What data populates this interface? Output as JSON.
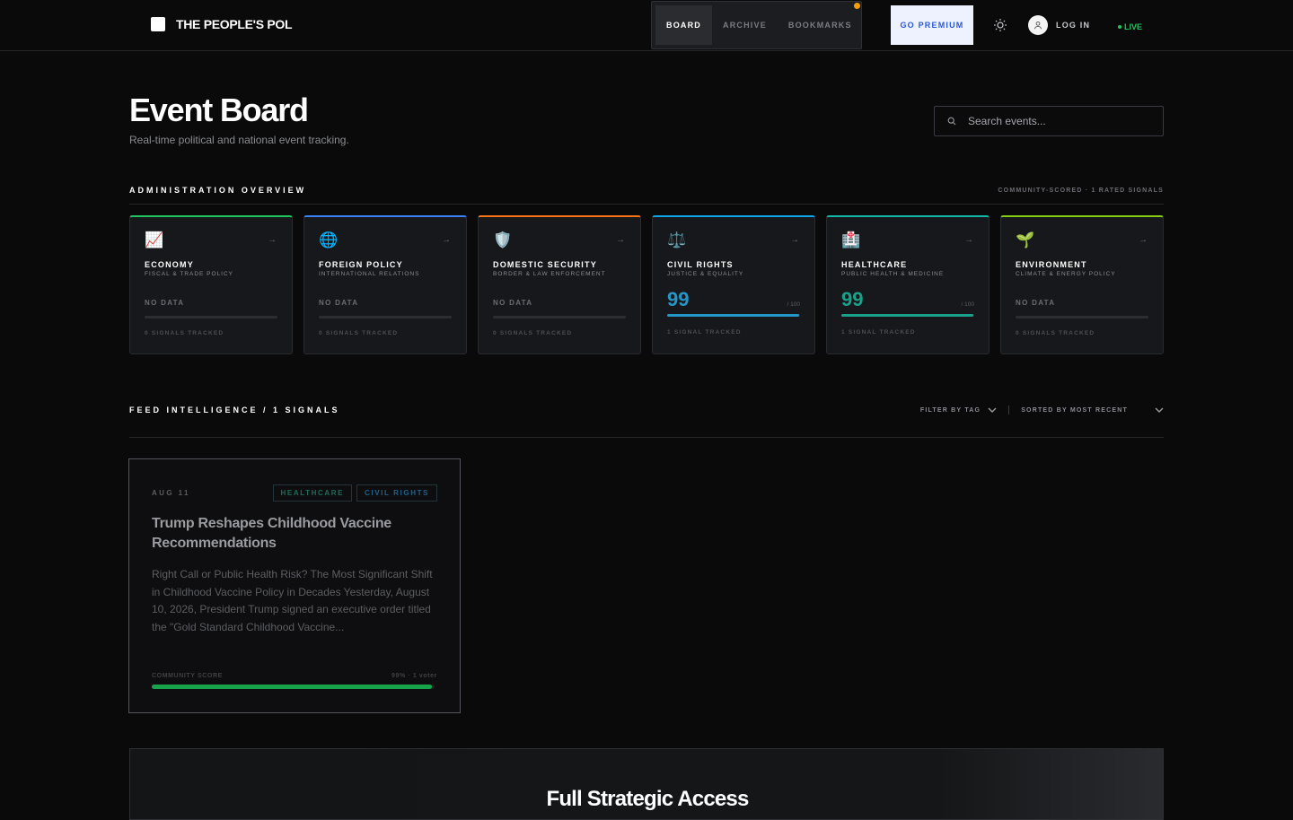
{
  "brand": {
    "name": "THE PEOPLE'S POL"
  },
  "nav": {
    "tabs": [
      "BOARD",
      "ARCHIVE",
      "BOOKMARKS"
    ],
    "active": "BOARD"
  },
  "header": {
    "premium_label": "GO PREMIUM",
    "login_label": "LOG IN",
    "live_label": "LIVE"
  },
  "page": {
    "title": "Event Board",
    "subtitle": "Real-time political and national event tracking.",
    "search_placeholder": "Search events..."
  },
  "overview": {
    "heading": "ADMINISTRATION OVERVIEW",
    "meta": "COMMUNITY-SCORED · 1 RATED SIGNALS",
    "cards": [
      {
        "icon": "📈",
        "icon_name": "chart-increasing-icon",
        "title": "ECONOMY",
        "subtitle": "FISCAL & TRADE POLICY",
        "status": "NO DATA",
        "tracked": "0 SIGNALS TRACKED",
        "accent": "#22c55e"
      },
      {
        "icon": "🌐",
        "icon_name": "globe-icon",
        "title": "FOREIGN POLICY",
        "subtitle": "INTERNATIONAL RELATIONS",
        "status": "NO DATA",
        "tracked": "0 SIGNALS TRACKED",
        "accent": "#3b82f6"
      },
      {
        "icon": "🛡️",
        "icon_name": "shield-icon",
        "title": "DOMESTIC SECURITY",
        "subtitle": "BORDER & LAW ENFORCEMENT",
        "status": "NO DATA",
        "tracked": "0 SIGNALS TRACKED",
        "accent": "#f97316"
      },
      {
        "icon": "⚖️",
        "icon_name": "scales-icon",
        "title": "CIVIL RIGHTS",
        "subtitle": "JUSTICE & EQUALITY",
        "score": "99",
        "score_max": "/ 100",
        "score_pct": 99,
        "tracked": "1 SIGNAL TRACKED",
        "accent": "#0ea5e9",
        "score_color": "#2596c8"
      },
      {
        "icon": "🏥",
        "icon_name": "hospital-icon",
        "title": "HEALTHCARE",
        "subtitle": "PUBLIC HEALTH & MEDICINE",
        "score": "99",
        "score_max": "/ 100",
        "score_pct": 99,
        "tracked": "1 SIGNAL TRACKED",
        "accent": "#14b8a6",
        "score_color": "#19a18a"
      },
      {
        "icon": "🌱",
        "icon_name": "seedling-icon",
        "title": "ENVIRONMENT",
        "subtitle": "CLIMATE & ENERGY POLICY",
        "status": "NO DATA",
        "tracked": "0 SIGNALS TRACKED",
        "accent": "#84cc16"
      }
    ],
    "arrow": "→"
  },
  "feed": {
    "heading": "FEED INTELLIGENCE / 1 SIGNALS",
    "filter_label": "FILTER BY TAG",
    "sort_label": "SORTED BY MOST RECENT",
    "events": [
      {
        "date": "AUG 11",
        "tags": [
          "HEALTHCARE",
          "CIVIL RIGHTS"
        ],
        "title": "Trump Reshapes Childhood Vaccine Recommendations",
        "body": "Right Call or Public Health Risk? The Most Significant Shift in Childhood Vaccine Policy in Decades Yesterday, August 10, 2026, President Trump signed an executive order titled the \"Gold Standard Childhood Vaccine...",
        "score_label": "COMMUNITY SCORE",
        "score_meta": "99% · 1 voter",
        "score_pct": 99
      }
    ]
  },
  "cta": {
    "title": "Full Strategic Access"
  }
}
